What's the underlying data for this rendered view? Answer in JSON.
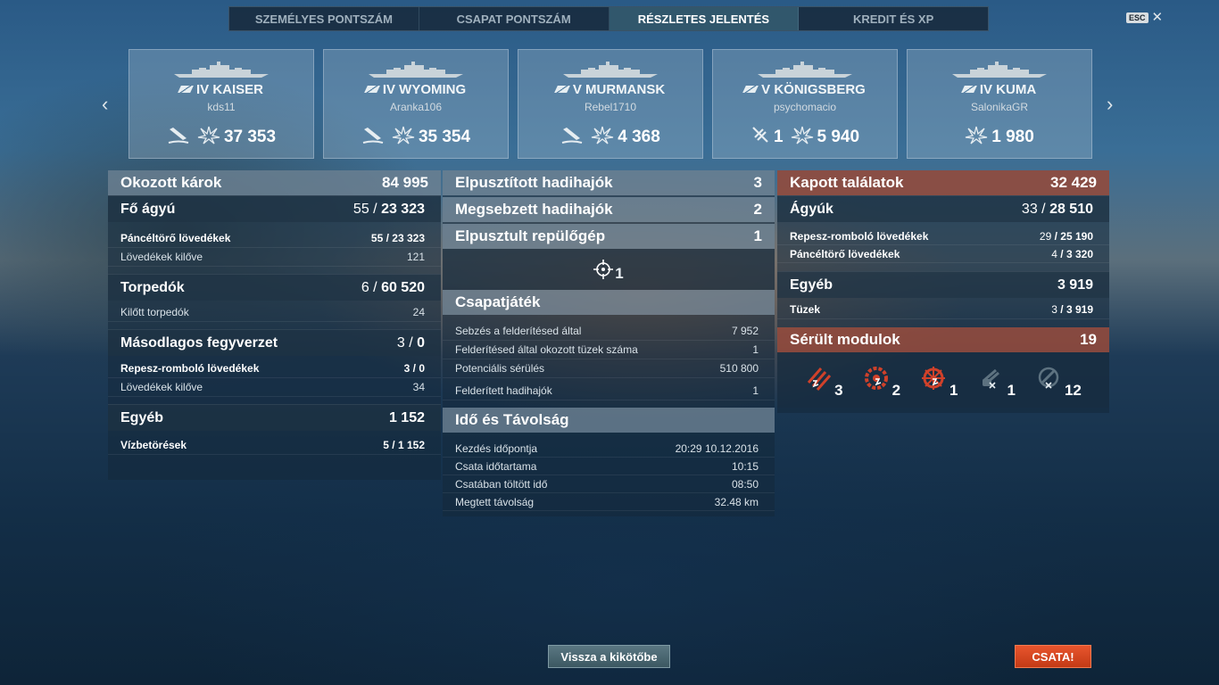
{
  "tabs": [
    {
      "label": "SZEMÉLYES PONTSZÁM",
      "active": false
    },
    {
      "label": "CSAPAT PONTSZÁM",
      "active": false
    },
    {
      "label": "RÉSZLETES JELENTÉS",
      "active": true
    },
    {
      "label": "KREDIT ÉS XP",
      "active": false
    }
  ],
  "esc_label": "ESC",
  "close_glyph": "✕",
  "nav": {
    "prev": "‹",
    "next": "›"
  },
  "ships": [
    {
      "name": "IV KAISER",
      "player": "kds11",
      "sunk_icon": true,
      "planes": null,
      "damage": "37 353"
    },
    {
      "name": "IV WYOMING",
      "player": "Aranka106",
      "sunk_icon": true,
      "planes": null,
      "damage": "35 354"
    },
    {
      "name": "V MURMANSK",
      "player": "Rebel1710",
      "sunk_icon": true,
      "planes": null,
      "damage": "4 368"
    },
    {
      "name": "V KÖNIGSBERG",
      "player": "psychomacio",
      "sunk_icon": false,
      "planes": "1",
      "damage": "5 940"
    },
    {
      "name": "IV KUMA",
      "player": "SalonikaGR",
      "sunk_icon": false,
      "planes": null,
      "damage": "1 980"
    }
  ],
  "left": {
    "header": {
      "label": "Okozott károk",
      "value": "84 995"
    },
    "main_guns": {
      "label": "Fő ágyú",
      "hits": "55",
      "damage": "23 323"
    },
    "main_rows": [
      {
        "label": "Páncéltörő lövedékek",
        "hits": "55",
        "damage": "23 323",
        "bold": true
      },
      {
        "label": "Lövedékek kilőve",
        "value": "121",
        "bold": false
      }
    ],
    "torpedoes": {
      "label": "Torpedók",
      "hits": "6",
      "damage": "60 520"
    },
    "torp_rows": [
      {
        "label": "Kilőtt torpedók",
        "value": "24"
      }
    ],
    "secondary": {
      "label": "Másodlagos fegyverzet",
      "hits": "3",
      "damage": "0"
    },
    "sec_rows": [
      {
        "label": "Repesz-romboló lövedékek",
        "hits": "3",
        "damage": "0",
        "bold": true
      },
      {
        "label": "Lövedékek kilőve",
        "value": "34",
        "bold": false
      }
    ],
    "other": {
      "label": "Egyéb",
      "value": "1 152"
    },
    "other_rows": [
      {
        "label": "Vízbetörések",
        "hits": "5",
        "damage": "1 152"
      }
    ]
  },
  "middle": {
    "destroyed": {
      "label": "Elpusztított hadihajók",
      "value": "3"
    },
    "damaged": {
      "label": "Megsebzett hadihajók",
      "value": "2"
    },
    "planes": {
      "label": "Elpusztult repülőgép",
      "value": "1"
    },
    "planes_icon_value": "1",
    "team": {
      "label": "Csapatjáték"
    },
    "team_rows": [
      {
        "label": "Sebzés a felderítésed által",
        "value": "7 952"
      },
      {
        "label": "Felderítésed által okozott tüzek száma",
        "value": "1"
      },
      {
        "label": "Potenciális sérülés",
        "value": "510 800"
      },
      {
        "label": "Felderített hadihajók",
        "value": "1"
      }
    ],
    "time": {
      "label": "Idő és Távolság"
    },
    "time_rows": [
      {
        "label": "Kezdés időpontja",
        "value": "20:29  10.12.2016"
      },
      {
        "label": "Csata időtartama",
        "value": "10:15"
      },
      {
        "label": "Csatában töltött idő",
        "value": "08:50"
      },
      {
        "label": "Megtett távolság",
        "value": "32.48 km"
      }
    ]
  },
  "right": {
    "header": {
      "label": "Kapott találatok",
      "value": "32 429"
    },
    "guns": {
      "label": "Ágyúk",
      "hits": "33",
      "damage": "28 510"
    },
    "gun_rows": [
      {
        "label": "Repesz-romboló lövedékek",
        "hits": "29",
        "damage": "25 190"
      },
      {
        "label": "Páncéltörő lövedékek",
        "hits": "4",
        "damage": "3 320"
      }
    ],
    "other": {
      "label": "Egyéb",
      "value": "3 919"
    },
    "other_rows": [
      {
        "label": "Tüzek",
        "hits": "3",
        "damage": "3 919"
      }
    ],
    "modules": {
      "label": "Sérült modulok",
      "value": "19"
    },
    "module_items": [
      {
        "icon": "torpedo-tubes-icon",
        "count": "3",
        "color": "#d0412a"
      },
      {
        "icon": "engine-icon",
        "count": "2",
        "color": "#d0412a"
      },
      {
        "icon": "steering-gear-icon",
        "count": "1",
        "color": "#d0412a"
      },
      {
        "icon": "main-gun-icon",
        "count": "1",
        "color": "#5d7280"
      },
      {
        "icon": "aa-gun-icon",
        "count": "12",
        "color": "#5d7280"
      }
    ]
  },
  "buttons": {
    "back": "Vissza a kikötőbe",
    "battle": "CSATA!"
  }
}
